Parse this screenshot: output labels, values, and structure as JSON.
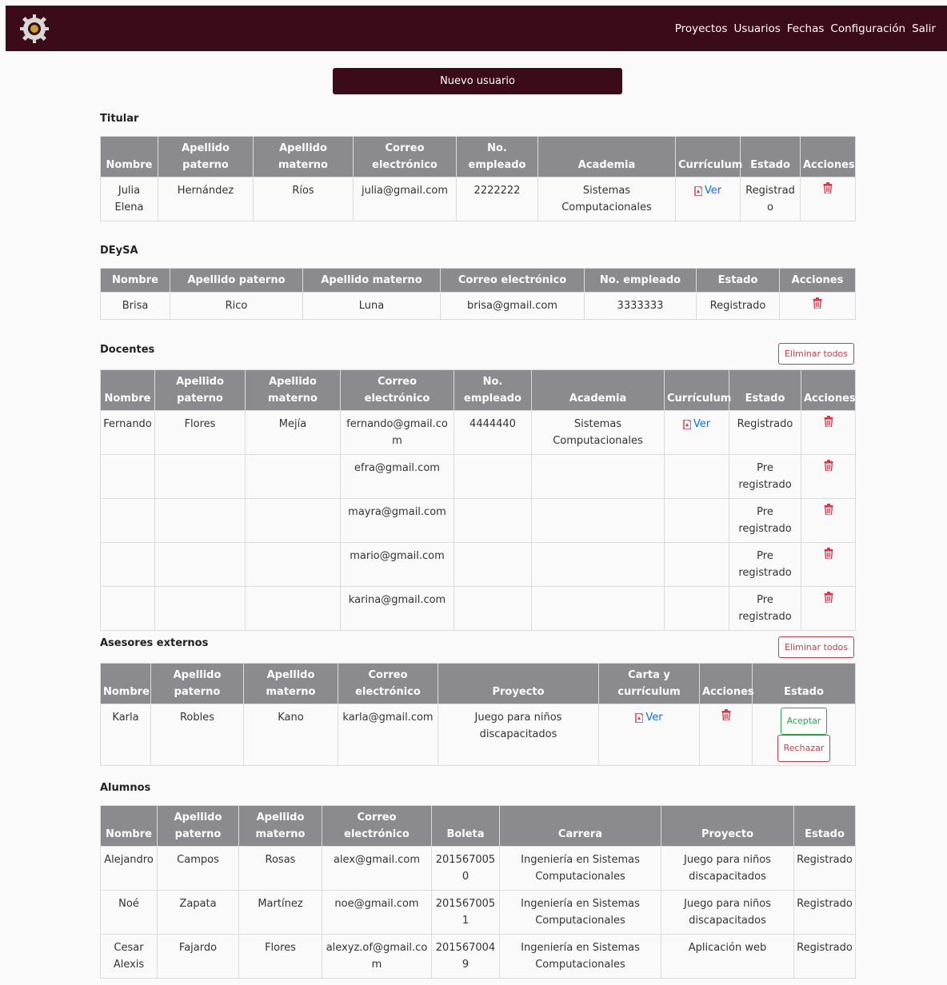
{
  "nav": {
    "links": [
      "Proyectos",
      "Usuarios",
      "Fechas",
      "Configuración",
      "Salir"
    ]
  },
  "new_user_label": "Nuevo usuario",
  "delete_all_label": "Eliminar todos",
  "ver_label": "Ver",
  "accept_label": "Aceptar",
  "reject_label": "Rechazar",
  "titular": {
    "title": "Titular",
    "headers": [
      "Nombre",
      "Apellido paterno",
      "Apellido materno",
      "Correo electrónico",
      "No. empleado",
      "Academia",
      "Currículum",
      "Estado",
      "Acciones"
    ],
    "rows": [
      [
        "Julia Elena",
        "Hernández",
        "Ríos",
        "julia@gmail.com",
        "2222222",
        "Sistemas Computacionales",
        "Ver",
        "Registrado",
        ""
      ]
    ]
  },
  "deysa": {
    "title": "DEySA",
    "headers": [
      "Nombre",
      "Apellido paterno",
      "Apellido materno",
      "Correo electrónico",
      "No. empleado",
      "Estado",
      "Acciones"
    ],
    "rows": [
      [
        "Brisa",
        "Rico",
        "Luna",
        "brisa@gmail.com",
        "3333333",
        "Registrado",
        ""
      ]
    ]
  },
  "docentes": {
    "title": "Docentes",
    "headers": [
      "Nombre",
      "Apellido paterno",
      "Apellido materno",
      "Correo electrónico",
      "No. empleado",
      "Academia",
      "Currículum",
      "Estado",
      "Acciones"
    ],
    "rows": [
      [
        "Fernando",
        "Flores",
        "Mejía",
        "fernando@gmail.com",
        "4444440",
        "Sistemas Computacionales",
        "Ver",
        "Registrado",
        ""
      ],
      [
        "",
        "",
        "",
        "efra@gmail.com",
        "",
        "",
        "",
        "Pre registrado",
        ""
      ],
      [
        "",
        "",
        "",
        "mayra@gmail.com",
        "",
        "",
        "",
        "Pre registrado",
        ""
      ],
      [
        "",
        "",
        "",
        "mario@gmail.com",
        "",
        "",
        "",
        "Pre registrado",
        ""
      ],
      [
        "",
        "",
        "",
        "karina@gmail.com",
        "",
        "",
        "",
        "Pre registrado",
        ""
      ]
    ]
  },
  "asesores": {
    "title": "Asesores externos",
    "headers": [
      "Nombre",
      "Apellido paterno",
      "Apellido materno",
      "Correo electrónico",
      "Proyecto",
      "Carta y currículum",
      "Acciones",
      "Estado"
    ],
    "rows": [
      [
        "Karla",
        "Robles",
        "Kano",
        "karla@gmail.com",
        "Juego para niños discapacitados",
        "Ver",
        "",
        ""
      ]
    ]
  },
  "alumnos": {
    "title": "Alumnos",
    "headers": [
      "Nombre",
      "Apellido paterno",
      "Apellido materno",
      "Correo electrónico",
      "Boleta",
      "Carrera",
      "Proyecto",
      "Estado"
    ],
    "rows": [
      [
        "Alejandro",
        "Campos",
        "Rosas",
        "alex@gmail.com",
        "2015670050",
        "Ingeniería en Sistemas Computacionales",
        "Juego para niños discapacitados",
        "Registrado"
      ],
      [
        "Noé",
        "Zapata",
        "Martínez",
        "noe@gmail.com",
        "2015670051",
        "Ingeniería en Sistemas Computacionales",
        "Juego para niños discapacitados",
        "Registrado"
      ],
      [
        "Cesar Alexis",
        "Fajardo",
        "Flores",
        "alexyz.of@gmail.com",
        "2015670049",
        "Ingeniería en Sistemas Computacionales",
        "Aplicación web",
        "Registrado"
      ]
    ]
  },
  "colors": {
    "brand": "#3c0b19",
    "header_bg": "#8a8a8f",
    "danger": "#dc3545",
    "link": "#0d6efd",
    "success": "#28a745"
  },
  "icons": {
    "logo": "gear-logo-icon",
    "pdf": "pdf-file-icon",
    "trash": "trash-icon"
  }
}
